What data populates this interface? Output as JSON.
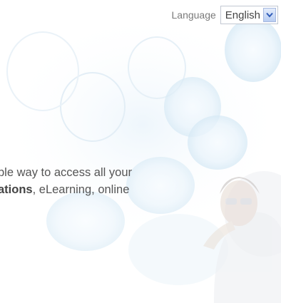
{
  "header": {
    "language_label": "Language",
    "language_selected": "English",
    "dropdown_icon": "chevron-down-icon"
  },
  "intro": {
    "line1": "ple way to access all your",
    "line2_bold": "ations",
    "line2_rest": ", eLearning, online"
  },
  "colors": {
    "background": "#ffffff",
    "text": "#555555",
    "select_arrow": "#2f5bb7"
  }
}
